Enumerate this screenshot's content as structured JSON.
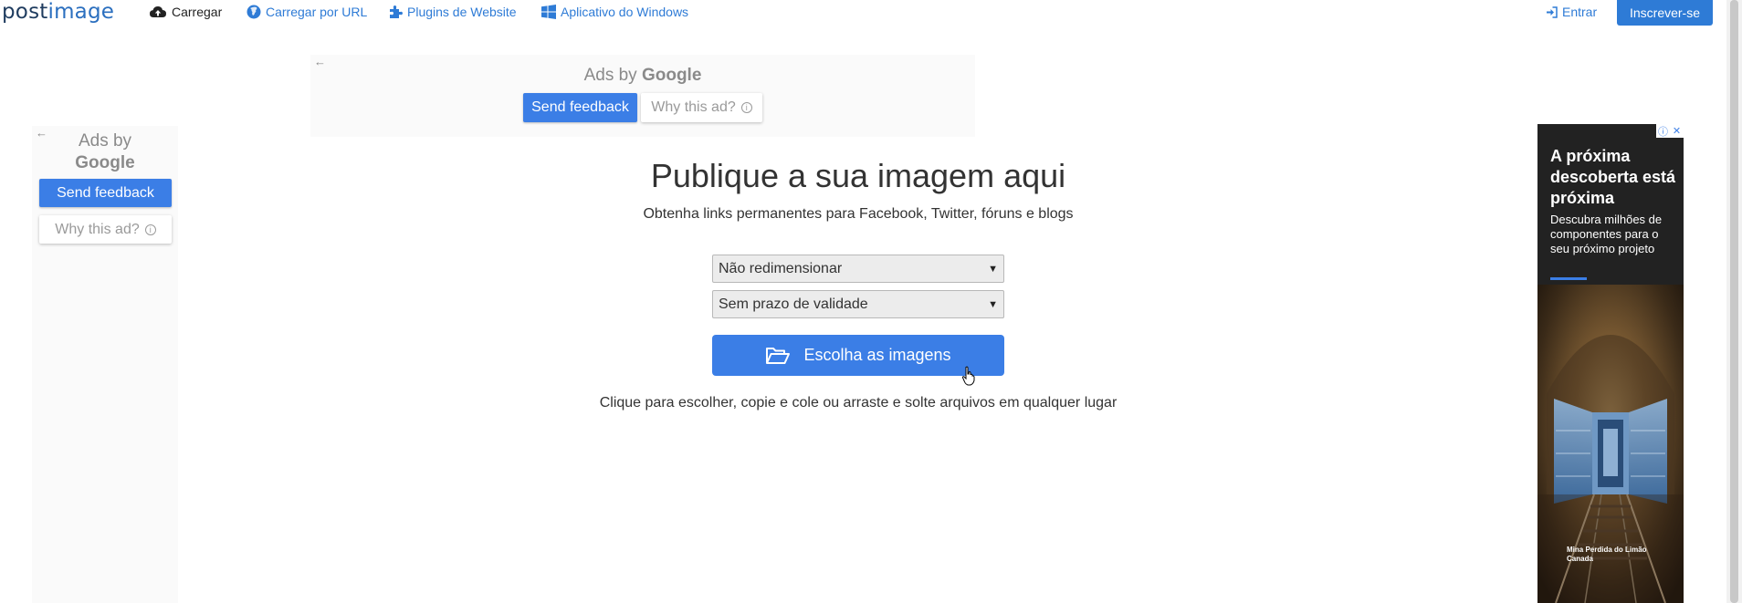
{
  "brand": {
    "logo_part1": "post",
    "logo_part2": "image"
  },
  "nav": {
    "upload": "Carregar",
    "upload_url": "Carregar por URL",
    "plugins": "Plugins de Website",
    "windows_app": "Aplicativo do Windows",
    "login": "Entrar",
    "register": "Inscrever-se"
  },
  "ad_top": {
    "ads_by": "Ads by",
    "google": "Google",
    "send_feedback": "Send feedback",
    "why_this_ad": "Why this ad?"
  },
  "ad_left": {
    "ads_by": "Ads by",
    "google": "Google",
    "send_feedback": "Send feedback",
    "why_this_ad": "Why this ad?"
  },
  "main": {
    "title": "Publique a sua imagem aqui",
    "subtitle": "Obtenha links permanentes para Facebook, Twitter, fóruns e blogs",
    "resize_select": "Não redimensionar",
    "expiry_select": "Sem prazo de validade",
    "choose_button": "Escolha as imagens",
    "hint": "Clique para escolher, copie e cole ou arraste e solte arquivos em qualquer lugar"
  },
  "ad_right": {
    "headline": "A próxima descoberta está próxima",
    "body": "Descubra milhões de componentes para o seu próximo projeto",
    "caption_line1": "Mina Perdida do Limão",
    "caption_line2": "Canada"
  },
  "colors": {
    "accent": "#3b7ee6",
    "nav_link": "#2e7bd6"
  },
  "icons": [
    "cloud-upload-icon",
    "globe-icon",
    "puzzle-icon",
    "windows-icon",
    "sign-in-icon",
    "folder-open-icon",
    "back-arrow-icon",
    "info-icon",
    "close-icon",
    "hand-cursor-icon"
  ]
}
